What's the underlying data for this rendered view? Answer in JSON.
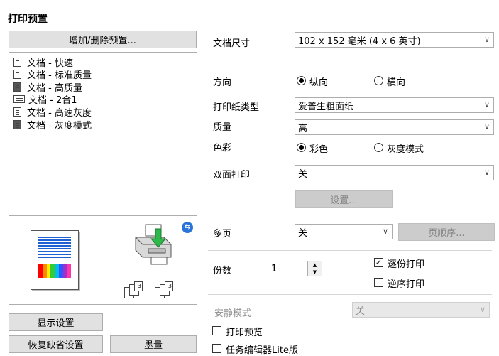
{
  "title": "打印预置",
  "preset_panel": {
    "add_remove_button": "增加/删除预置...",
    "presets": [
      {
        "label": "文档 - 快速",
        "icon": "document-icon"
      },
      {
        "label": "文档 - 标准质量",
        "icon": "document-icon"
      },
      {
        "label": "文档 - 高质量",
        "icon": "document-icon"
      },
      {
        "label": "文档 - 2合1",
        "icon": "two-up-document-icon"
      },
      {
        "label": "文档 - 高速灰度",
        "icon": "document-icon"
      },
      {
        "label": "文档 - 灰度模式",
        "icon": "document-icon"
      }
    ]
  },
  "preview": {
    "page_number_left": "12",
    "page_number_right": "12",
    "copy_suffix": "3"
  },
  "left_buttons": {
    "show_settings": "显示设置",
    "restore_defaults": "恢复缺省设置",
    "ink_levels": "墨量"
  },
  "settings": {
    "paper_size": {
      "label": "文档尺寸",
      "value": "102 x 152 毫米 (4 x 6 英寸)"
    },
    "orientation": {
      "label": "方向",
      "portrait": "纵向",
      "landscape": "横向",
      "selected": "portrait"
    },
    "paper_type": {
      "label": "打印纸类型",
      "value": "爱普生粗面纸"
    },
    "quality": {
      "label": "质量",
      "value": "高"
    },
    "color": {
      "label": "色彩",
      "color_option": "彩色",
      "grayscale_option": "灰度模式",
      "selected": "color"
    },
    "duplex": {
      "label": "双面打印",
      "value": "关",
      "settings_button": "设置..."
    },
    "multi_page": {
      "label": "多页",
      "value": "关",
      "page_order_button": "页顺序..."
    },
    "copies": {
      "label": "份数",
      "value": "1",
      "collate_label": "逐份打印",
      "collate_checked": true,
      "reverse_label": "逆序打印",
      "reverse_checked": false
    },
    "quiet_mode": {
      "label": "安静模式",
      "value": "关"
    },
    "print_preview": {
      "label": "打印预览",
      "checked": false
    },
    "job_arranger": {
      "label": "任务编辑器Lite版",
      "checked": false
    }
  },
  "colors": {
    "rainbow": [
      "#ff0000",
      "#ff8800",
      "#ffee00",
      "#33cc33",
      "#00bbee",
      "#3355ff",
      "#9933cc",
      "#ff33aa"
    ],
    "preview_lines": "#1f5fd4",
    "arrow": "#2db84a",
    "badge": "#2a73d9"
  }
}
